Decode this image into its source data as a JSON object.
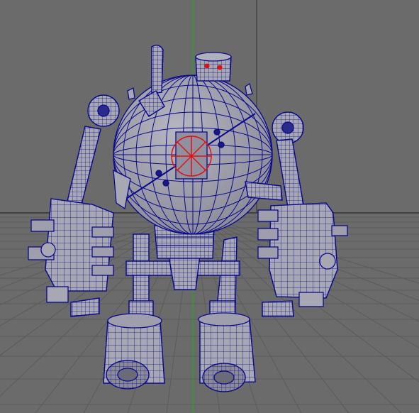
{
  "viewport": {
    "background": "#6b6b6b",
    "grid_color": "#5a5a5a",
    "grid_major_color": "#1f1f1f",
    "axis_vertical_color": "#1ea81e"
  },
  "model": {
    "shaded_color": "#a8a8b4",
    "shadow_color": "#8d8d9c",
    "wireframe_color": "#0a0a8c",
    "selection_color": "#e01010",
    "eye_color": "#e01010"
  }
}
